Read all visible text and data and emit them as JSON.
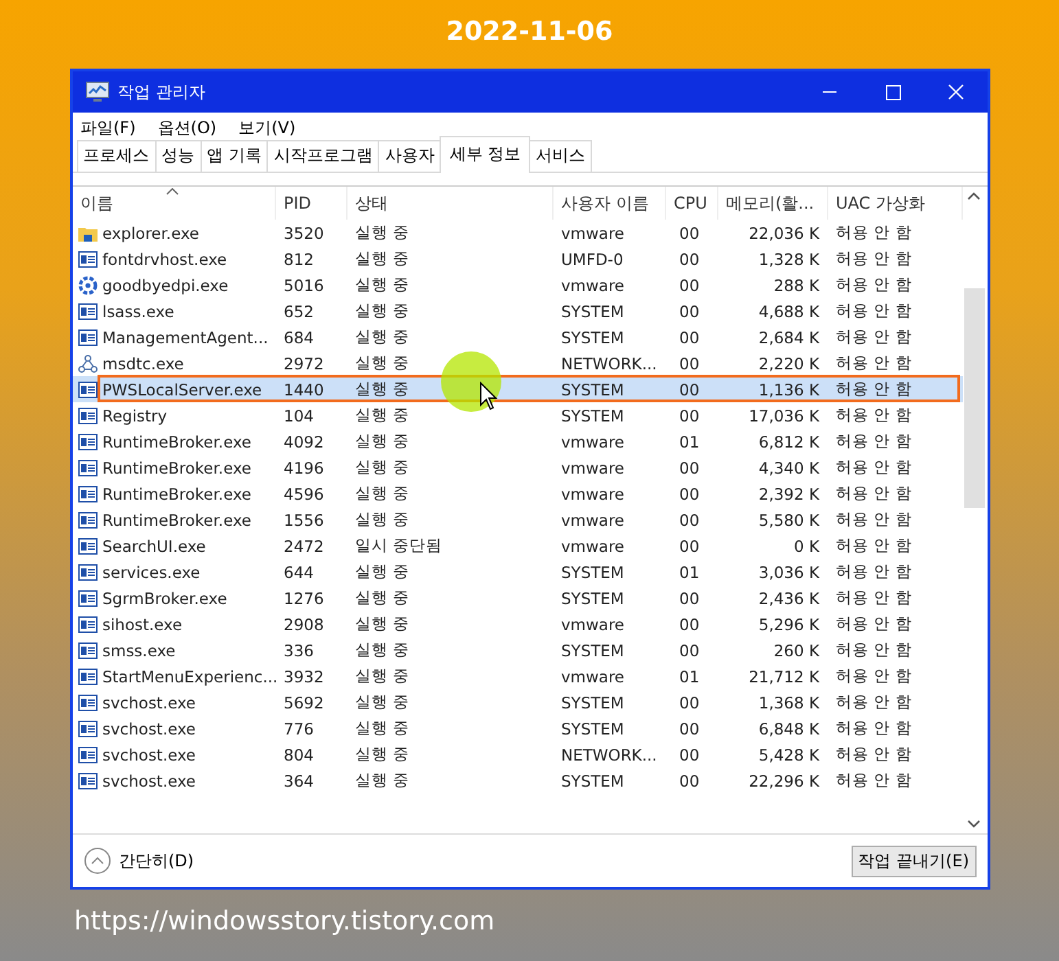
{
  "banner": {
    "date": "2022-11-06",
    "url": "https://windowsstory.tistory.com"
  },
  "window": {
    "title": "작업 관리자"
  },
  "menu": [
    "파일(F)",
    "옵션(O)",
    "보기(V)"
  ],
  "tabs": [
    {
      "label": "프로세스",
      "selected": false
    },
    {
      "label": "성능",
      "selected": false
    },
    {
      "label": "앱 기록",
      "selected": false
    },
    {
      "label": "시작프로그램",
      "selected": false
    },
    {
      "label": "사용자",
      "selected": false
    },
    {
      "label": "세부 정보",
      "selected": true
    },
    {
      "label": "서비스",
      "selected": false
    }
  ],
  "table": {
    "columns": [
      "이름",
      "PID",
      "상태",
      "사용자 이름",
      "CPU",
      "메모리(활...",
      "UAC 가상화"
    ],
    "rows": [
      {
        "kind": "folder",
        "selected": false,
        "cells": [
          "explorer.exe",
          "3520",
          "실행 중",
          "vmware",
          "00",
          "22,036 K",
          "허용 안 함"
        ]
      },
      {
        "kind": "app",
        "selected": false,
        "cells": [
          "fontdrvhost.exe",
          "812",
          "실행 중",
          "UMFD-0",
          "00",
          "1,328 K",
          "허용 안 함"
        ]
      },
      {
        "kind": "gear",
        "selected": false,
        "cells": [
          "goodbyedpi.exe",
          "5016",
          "실행 중",
          "vmware",
          "00",
          "288 K",
          "허용 안 함"
        ]
      },
      {
        "kind": "app",
        "selected": false,
        "cells": [
          "lsass.exe",
          "652",
          "실행 중",
          "SYSTEM",
          "00",
          "4,688 K",
          "허용 안 함"
        ]
      },
      {
        "kind": "app",
        "selected": false,
        "cells": [
          "ManagementAgent...",
          "684",
          "실행 중",
          "SYSTEM",
          "00",
          "2,684 K",
          "허용 안 함"
        ]
      },
      {
        "kind": "network",
        "selected": false,
        "cells": [
          "msdtc.exe",
          "2972",
          "실행 중",
          "NETWORK...",
          "00",
          "2,220 K",
          "허용 안 함"
        ]
      },
      {
        "kind": "app",
        "selected": true,
        "cells": [
          "PWSLocalServer.exe",
          "1440",
          "실행 중",
          "SYSTEM",
          "00",
          "1,136 K",
          "허용 안 함"
        ]
      },
      {
        "kind": "app",
        "selected": false,
        "cells": [
          "Registry",
          "104",
          "실행 중",
          "SYSTEM",
          "00",
          "17,036 K",
          "허용 안 함"
        ]
      },
      {
        "kind": "app",
        "selected": false,
        "cells": [
          "RuntimeBroker.exe",
          "4092",
          "실행 중",
          "vmware",
          "01",
          "6,812 K",
          "허용 안 함"
        ]
      },
      {
        "kind": "app",
        "selected": false,
        "cells": [
          "RuntimeBroker.exe",
          "4196",
          "실행 중",
          "vmware",
          "00",
          "4,340 K",
          "허용 안 함"
        ]
      },
      {
        "kind": "app",
        "selected": false,
        "cells": [
          "RuntimeBroker.exe",
          "4596",
          "실행 중",
          "vmware",
          "00",
          "2,392 K",
          "허용 안 함"
        ]
      },
      {
        "kind": "app",
        "selected": false,
        "cells": [
          "RuntimeBroker.exe",
          "1556",
          "실행 중",
          "vmware",
          "00",
          "5,580 K",
          "허용 안 함"
        ]
      },
      {
        "kind": "app",
        "selected": false,
        "cells": [
          "SearchUI.exe",
          "2472",
          "일시 중단됨",
          "vmware",
          "00",
          "0 K",
          "허용 안 함"
        ]
      },
      {
        "kind": "app",
        "selected": false,
        "cells": [
          "services.exe",
          "644",
          "실행 중",
          "SYSTEM",
          "01",
          "3,036 K",
          "허용 안 함"
        ]
      },
      {
        "kind": "app",
        "selected": false,
        "cells": [
          "SgrmBroker.exe",
          "1276",
          "실행 중",
          "SYSTEM",
          "00",
          "2,436 K",
          "허용 안 함"
        ]
      },
      {
        "kind": "app",
        "selected": false,
        "cells": [
          "sihost.exe",
          "2908",
          "실행 중",
          "vmware",
          "00",
          "5,296 K",
          "허용 안 함"
        ]
      },
      {
        "kind": "app",
        "selected": false,
        "cells": [
          "smss.exe",
          "336",
          "실행 중",
          "SYSTEM",
          "00",
          "260 K",
          "허용 안 함"
        ]
      },
      {
        "kind": "app",
        "selected": false,
        "cells": [
          "StartMenuExperienc...",
          "3932",
          "실행 중",
          "vmware",
          "01",
          "21,712 K",
          "허용 안 함"
        ]
      },
      {
        "kind": "app",
        "selected": false,
        "cells": [
          "svchost.exe",
          "5692",
          "실행 중",
          "SYSTEM",
          "00",
          "1,368 K",
          "허용 안 함"
        ]
      },
      {
        "kind": "app",
        "selected": false,
        "cells": [
          "svchost.exe",
          "776",
          "실행 중",
          "SYSTEM",
          "00",
          "6,848 K",
          "허용 안 함"
        ]
      },
      {
        "kind": "app",
        "selected": false,
        "cells": [
          "svchost.exe",
          "804",
          "실행 중",
          "NETWORK...",
          "00",
          "5,428 K",
          "허용 안 함"
        ]
      },
      {
        "kind": "app",
        "selected": false,
        "cells": [
          "svchost.exe",
          "364",
          "실행 중",
          "SYSTEM",
          "00",
          "22,296 K",
          "허용 안 함"
        ]
      }
    ]
  },
  "footer": {
    "collapse": "간단히(D)",
    "end_task": "작업 끝내기(E)"
  }
}
